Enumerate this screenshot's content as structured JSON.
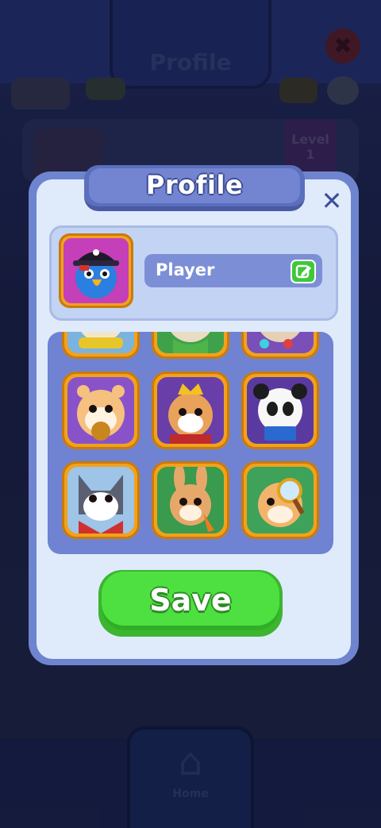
{
  "background": {
    "title": "Profile",
    "level_label": "Level",
    "level_value": "1",
    "name_preview": "Player",
    "nav_home_label": "Home",
    "close_glyph": "✖",
    "home_icon": "house-icon",
    "settings_icon": "gear-icon"
  },
  "modal": {
    "title": "Profile",
    "close_glyph": "✕",
    "close_icon": "close-icon",
    "player_name": "Player",
    "edit_icon": "edit-icon",
    "selected_avatar": "parrot-pirate-avatar",
    "save_label": "Save"
  },
  "avatars": [
    {
      "name": "cat-yellow-scarf-avatar"
    },
    {
      "name": "dog-green-avatar"
    },
    {
      "name": "monkey-gems-avatar"
    },
    {
      "name": "hamster-cookie-avatar"
    },
    {
      "name": "cat-crown-avatar"
    },
    {
      "name": "panda-book-avatar"
    },
    {
      "name": "wolf-bandana-avatar"
    },
    {
      "name": "bunny-carrot-avatar"
    },
    {
      "name": "hamster-magnifier-avatar"
    }
  ],
  "colors": {
    "modal_border": "#6f84cf",
    "modal_body": "#dfeafb",
    "title_tab": "#7384d0",
    "tile_frame": "#f2a21a",
    "save_green": "#4ee040",
    "edit_green": "#3fc83a"
  }
}
